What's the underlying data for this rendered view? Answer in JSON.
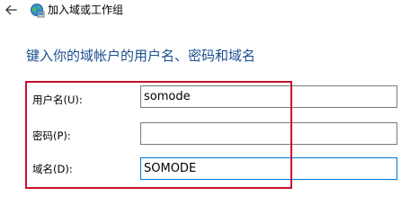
{
  "window": {
    "title": "加入域或工作组",
    "back_icon": "back-arrow-icon",
    "app_icon": "network-globe-icon"
  },
  "heading": "键入你的域帐户的用户名、密码和域名",
  "form": {
    "username": {
      "label": "用户名(U):",
      "value": "somode"
    },
    "password": {
      "label": "密码(P):",
      "value": ""
    },
    "domain": {
      "label": "域名(D):",
      "value": "SOMODE"
    }
  },
  "colors": {
    "heading": "#1c4f8f",
    "highlight_border": "#c8102e",
    "focus_border": "#0078d7"
  }
}
